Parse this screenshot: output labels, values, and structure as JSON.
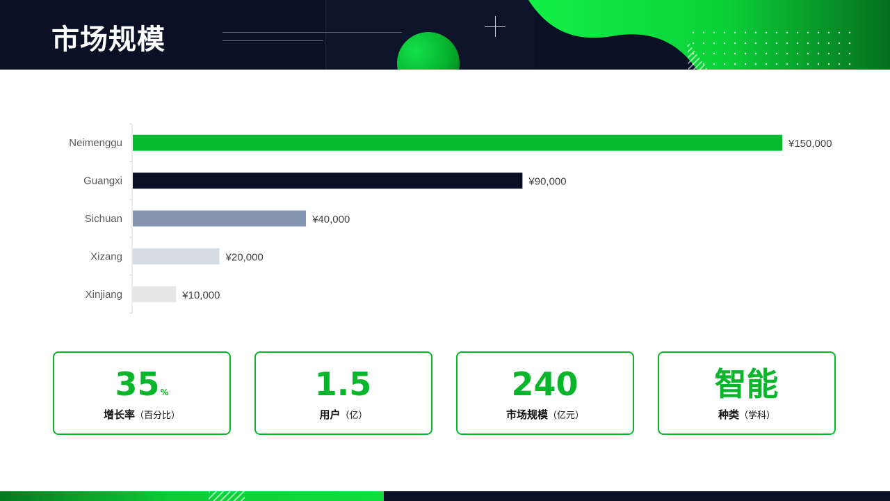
{
  "page": {
    "title": "市场规模"
  },
  "colors": {
    "navy": "#0b1125",
    "green": "#09b52b",
    "bar_colors": [
      "#09bb2e",
      "#0b1125",
      "#8496b0",
      "#d6dce4",
      "#e7e6e6"
    ]
  },
  "chart_data": {
    "type": "bar",
    "orientation": "horizontal",
    "categories": [
      "Neimenggu",
      "Guangxi",
      "Sichuan",
      "Xizang",
      "Xinjiang"
    ],
    "values": [
      150000,
      90000,
      40000,
      20000,
      10000
    ],
    "data_labels": [
      "¥150,000",
      "¥90,000",
      "¥40,000",
      "¥20,000",
      "¥10,000"
    ],
    "xlim": [
      0,
      150000
    ],
    "grid": false,
    "legend": "none"
  },
  "stats": [
    {
      "value": "35",
      "unit": "%",
      "label": "增长率",
      "sub": "（百分比）"
    },
    {
      "value": "1.5",
      "unit": "",
      "label": "用户",
      "sub": "（亿）"
    },
    {
      "value": "240",
      "unit": "",
      "label": "市场规模",
      "sub": "（亿元）"
    },
    {
      "value": "智能",
      "unit": "",
      "label": "种类",
      "sub": "（学科）"
    }
  ]
}
